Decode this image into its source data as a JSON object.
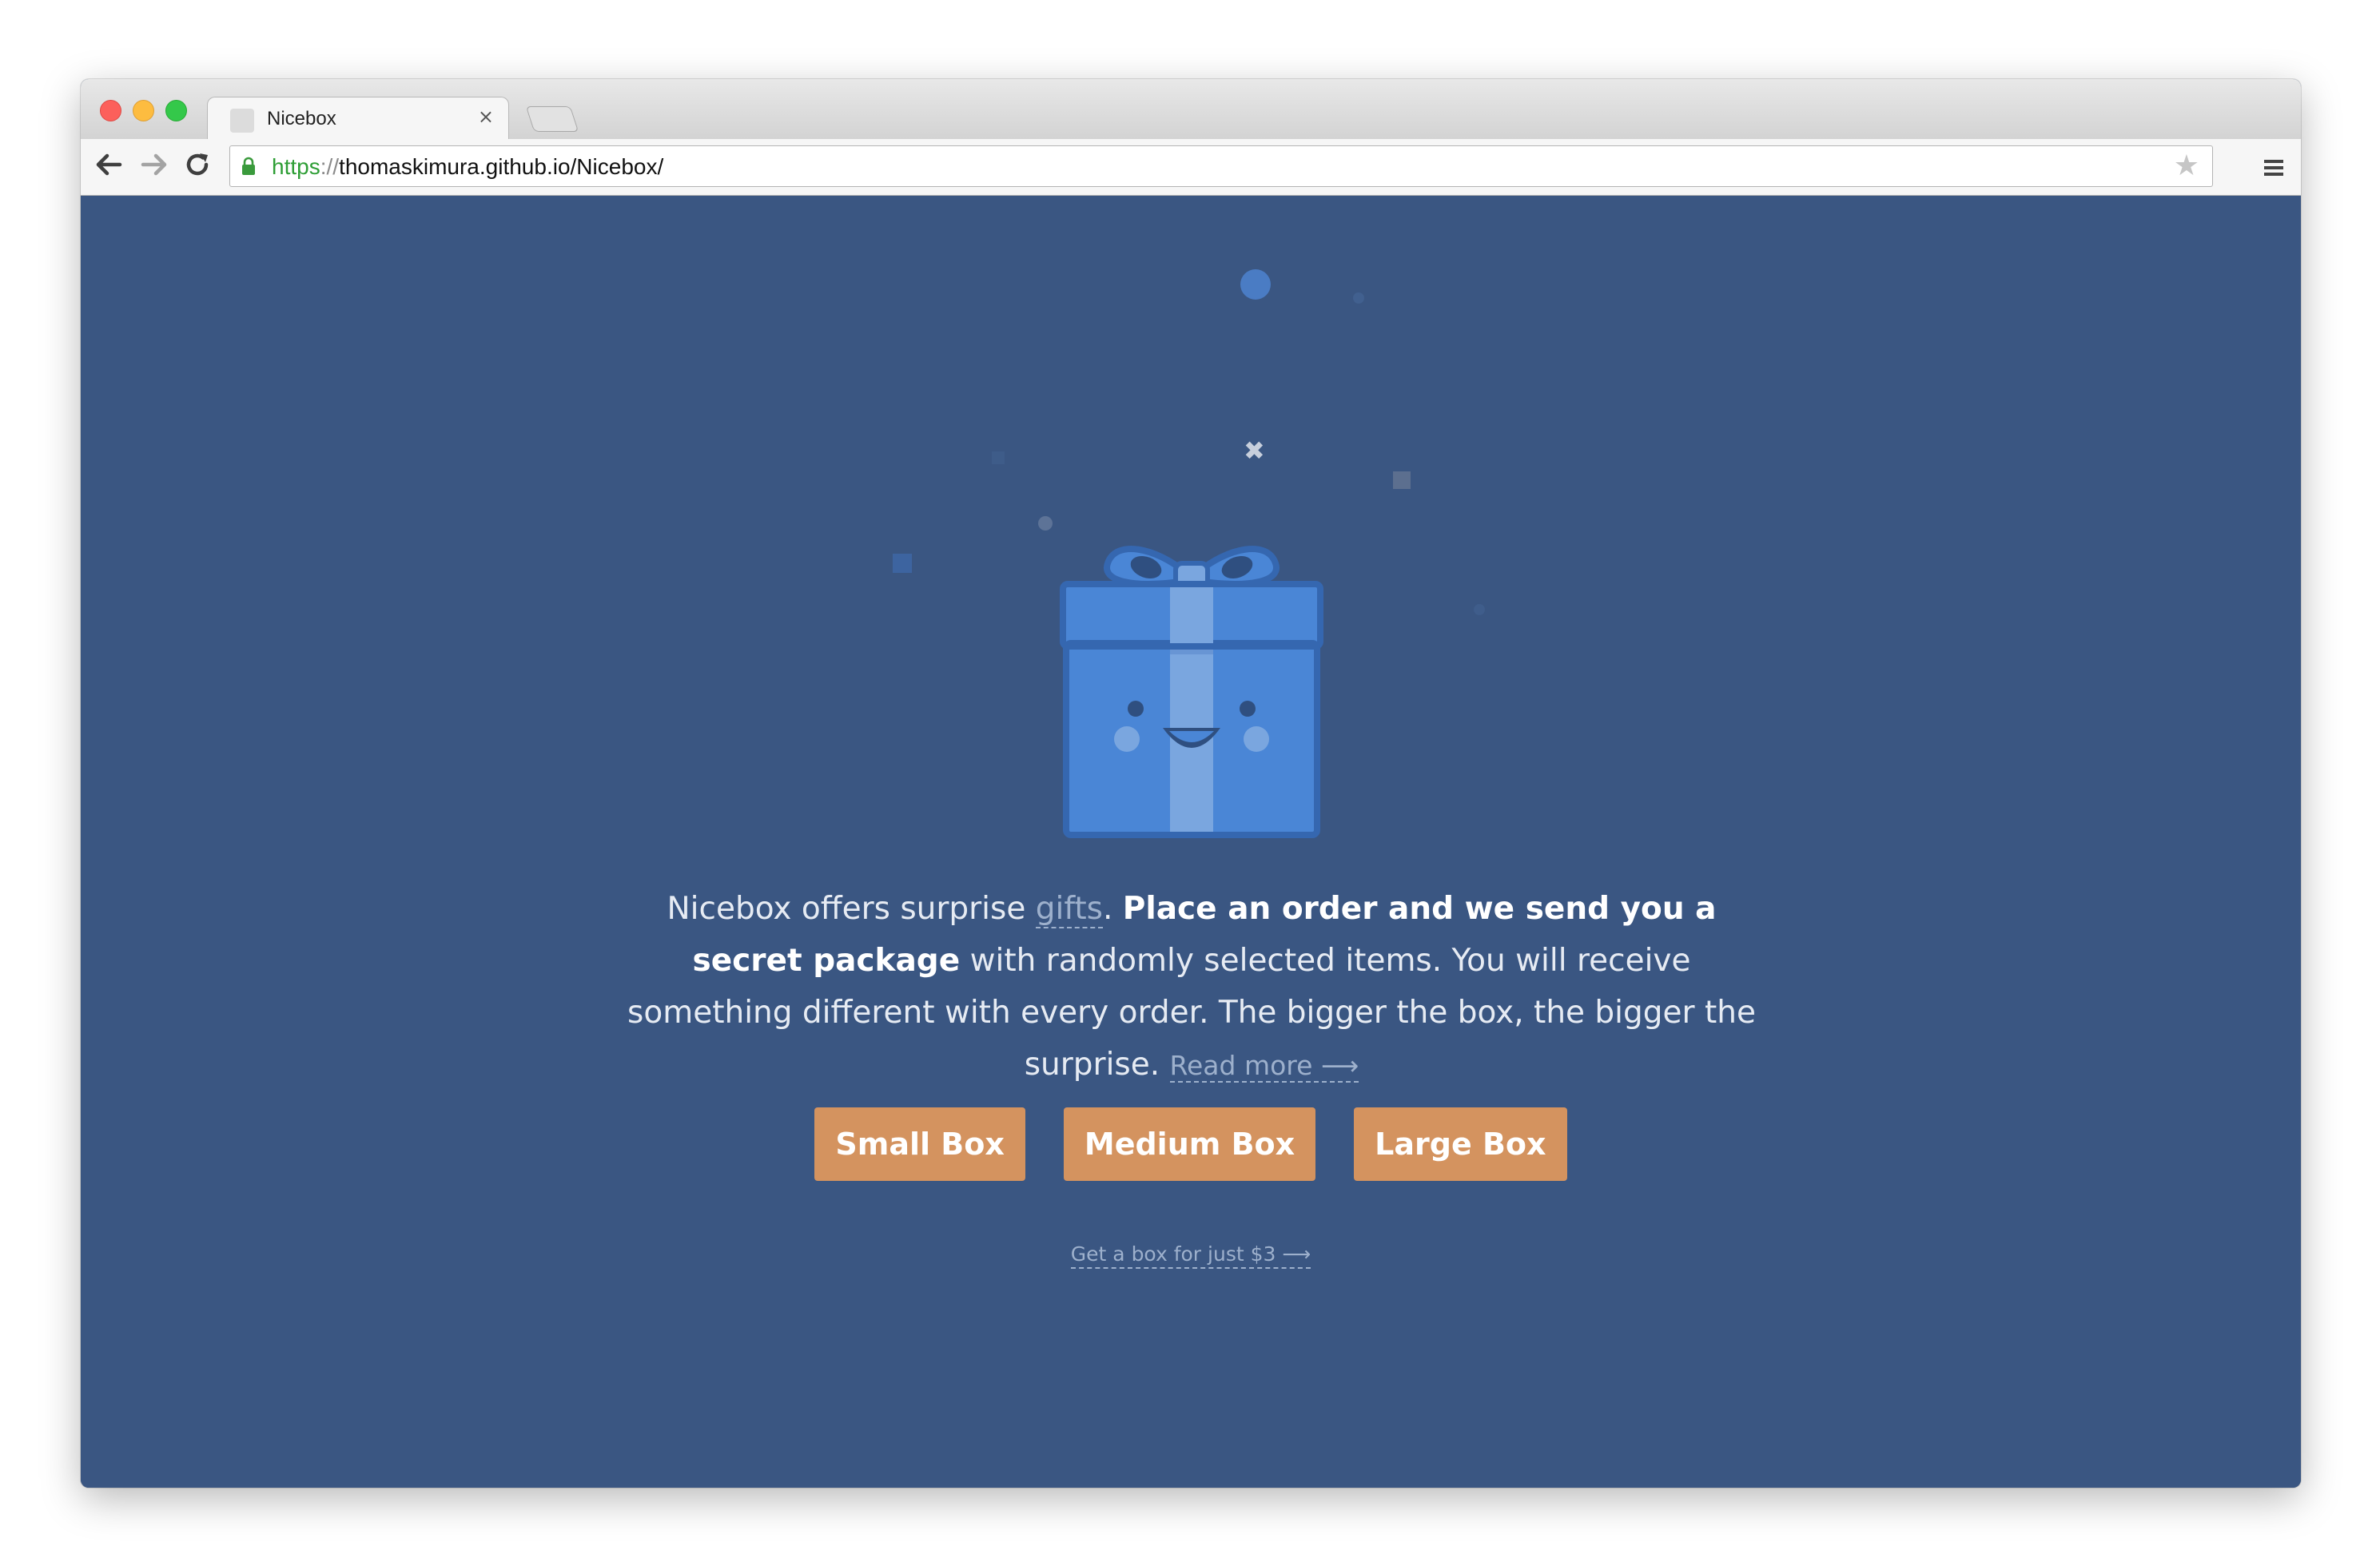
{
  "browser": {
    "tab_title": "Nicebox",
    "tab_close": "×",
    "url_scheme": "https",
    "url_separator": "://",
    "url_rest": "thomaskimura.github.io/Nicebox/",
    "icons": [
      "back-arrow-icon",
      "forward-arrow-icon",
      "reload-icon",
      "lock-icon",
      "star-icon",
      "menu-icon"
    ]
  },
  "intro": {
    "text_before_link": "Nicebox offers surprise ",
    "gifts_link": "gifts",
    "after_link": ". ",
    "bold_text": "Place an order and we send you a secret package",
    "text_rest": " with randomly selected items. You will receive something different with every order. The bigger the box, the bigger the surprise. ",
    "read_more": "Read more ⟶"
  },
  "buttons": {
    "small": "Small Box",
    "medium": "Medium Box",
    "large": "Large Box"
  },
  "cheap_link": "Get a box for just $3 ⟶",
  "colors": {
    "background": "#3a5682",
    "button": "#d4935f",
    "gift_blue": "#4a86d6",
    "gift_ribbon": "#7aa6df"
  }
}
